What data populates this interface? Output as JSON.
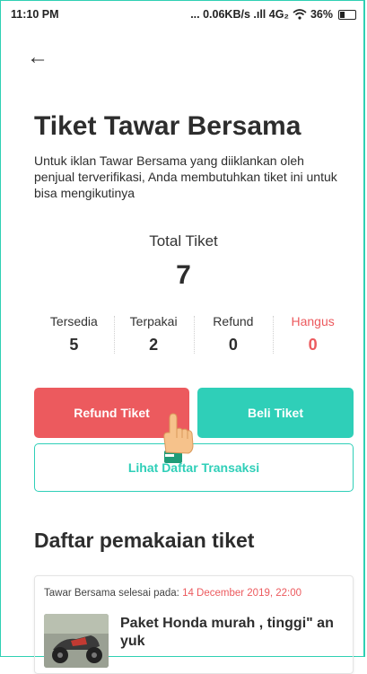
{
  "status_bar": {
    "time": "11:10 PM",
    "network": "... 0.06KB/s .ıll 4G₂",
    "wifi": "◔",
    "battery": "36%"
  },
  "header": {
    "back_icon": "←"
  },
  "page": {
    "title": "Tiket Tawar Bersama",
    "description": "Untuk iklan Tawar Bersama yang diiklankan oleh penjual terverifikasi, Anda membutuhkan tiket ini untuk bisa mengikutinya"
  },
  "total": {
    "label": "Total Tiket",
    "value": "7"
  },
  "stats": [
    {
      "label": "Tersedia",
      "value": "5"
    },
    {
      "label": "Terpakai",
      "value": "2"
    },
    {
      "label": "Refund",
      "value": "0"
    },
    {
      "label": "Hangus",
      "value": "0"
    }
  ],
  "buttons": {
    "refund": "Refund Tiket",
    "buy": "Beli Tiket",
    "transactions": "Lihat Daftar Transaksi"
  },
  "section": {
    "title": "Daftar pemakaian tiket"
  },
  "usage_card": {
    "meta_prefix": "Tawar Bersama selesai pada: ",
    "date": "14 December 2019, 22:00",
    "title": "Paket Honda murah , tinggi\" an yuk"
  },
  "colors": {
    "accent": "#2fcfb8",
    "danger": "#ec5a5e"
  }
}
